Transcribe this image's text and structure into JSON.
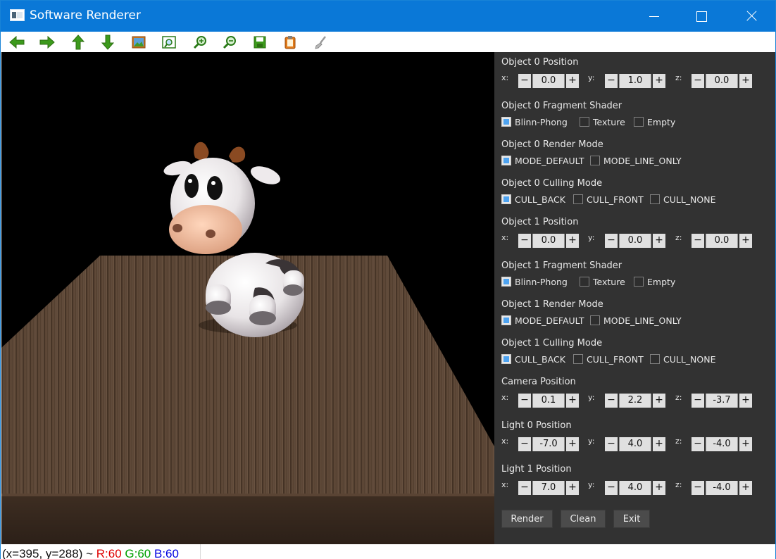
{
  "window": {
    "title": "Software Renderer"
  },
  "toolbar": [
    {
      "name": "arrow-left-icon"
    },
    {
      "name": "arrow-right-icon"
    },
    {
      "name": "arrow-up-icon"
    },
    {
      "name": "arrow-down-icon"
    },
    {
      "name": "image-icon"
    },
    {
      "name": "fit-view-icon"
    },
    {
      "name": "zoom-in-icon"
    },
    {
      "name": "zoom-out-icon"
    },
    {
      "name": "save-icon"
    },
    {
      "name": "clipboard-icon"
    },
    {
      "name": "brush-icon"
    }
  ],
  "panel": {
    "obj0": {
      "pos_title": "Object 0 Position",
      "x": "0.0",
      "y": "1.0",
      "z": "0.0",
      "shader_title": "Object 0 Fragment Shader",
      "shader_opts": [
        "Blinn-Phong",
        "Texture",
        "Empty"
      ],
      "render_title": "Object 0 Render Mode",
      "render_opts": [
        "MODE_DEFAULT",
        "MODE_LINE_ONLY"
      ],
      "cull_title": "Object 0 Culling Mode",
      "cull_opts": [
        "CULL_BACK",
        "CULL_FRONT",
        "CULL_NONE"
      ]
    },
    "obj1": {
      "pos_title": "Object 1 Position",
      "x": "0.0",
      "y": "0.0",
      "z": "0.0",
      "shader_title": "Object 1 Fragment Shader",
      "shader_opts": [
        "Blinn-Phong",
        "Texture",
        "Empty"
      ],
      "render_title": "Object 1 Render Mode",
      "render_opts": [
        "MODE_DEFAULT",
        "MODE_LINE_ONLY"
      ],
      "cull_title": "Object 1 Culling Mode",
      "cull_opts": [
        "CULL_BACK",
        "CULL_FRONT",
        "CULL_NONE"
      ]
    },
    "camera": {
      "title": "Camera Position",
      "x": "0.1",
      "y": "2.2",
      "z": "-3.7"
    },
    "light0": {
      "title": "Light 0 Position",
      "x": "-7.0",
      "y": "4.0",
      "z": "-4.0"
    },
    "light1": {
      "title": "Light 1 Position",
      "x": "7.0",
      "y": "4.0",
      "z": "-4.0"
    },
    "axis": {
      "x": "x:",
      "y": "y:",
      "z": "z:"
    },
    "stepper": {
      "minus": "−",
      "plus": "+"
    },
    "buttons": {
      "render": "Render",
      "clean": "Clean",
      "exit": "Exit"
    }
  },
  "status": {
    "coords": "(x=395, y=288) ~ ",
    "r": "R:60",
    "g": "G:60",
    "b": "B:60",
    "colors": {
      "r": "#e00000",
      "g": "#00a000",
      "b": "#0000e0"
    }
  }
}
